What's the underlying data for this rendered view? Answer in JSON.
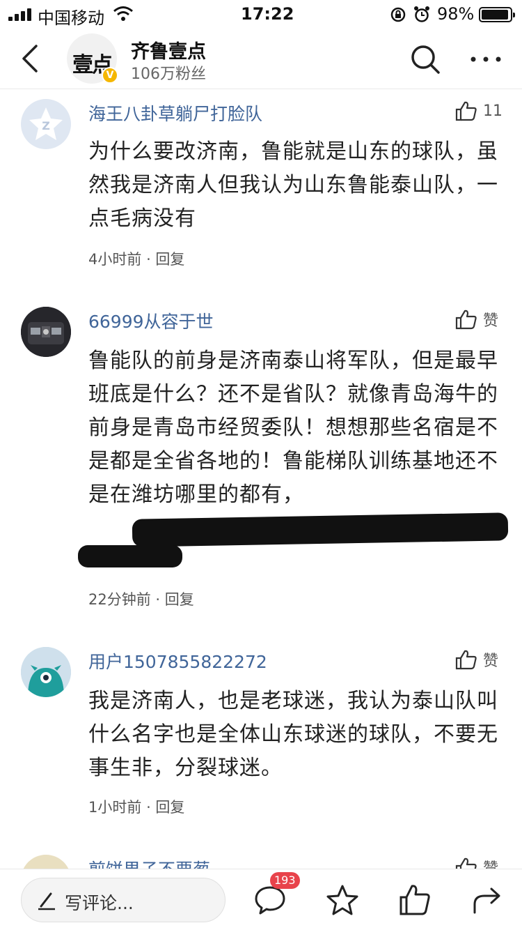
{
  "status_bar": {
    "carrier": "中国移动",
    "time": "17:22",
    "battery": "98%",
    "battery_level": 0.98
  },
  "header": {
    "account_name": "齐鲁壹点",
    "fans": "106万粉丝",
    "logo_text": "壹点"
  },
  "comments": [
    {
      "user": "海王八卦草躺尸打脸队",
      "likes": "11",
      "text": "为什么要改济南，鲁能就是山东的球队，虽然我是济南人但我认为山东鲁能泰山队，一点毛病没有",
      "time": "4小时前",
      "reply": "回复"
    },
    {
      "user": "66999从容于世",
      "likes": "赞",
      "text": "鲁能队的前身是济南泰山将军队，但是最早班底是什么？还不是省队？就像青岛海牛的前身是青岛市经贸委队！想想那些名宿是不是都是全省各地的！鲁能梯队训练基地还不是在潍坊哪里的都有，",
      "time": "22分钟前",
      "reply": "回复"
    },
    {
      "user": "用户1507855822272",
      "likes": "赞",
      "text": "我是济南人，也是老球迷，我认为泰山队叫什么名字也是全体山东球迷的球队，不要无事生非，分裂球迷。",
      "time": "1小时前",
      "reply": "回复"
    },
    {
      "user": "煎饼果子不要葱",
      "likes": "赞"
    }
  ],
  "bottom_bar": {
    "input_placeholder": "写评论...",
    "comment_count": "193"
  },
  "colors": {
    "username": "#406599",
    "badge": "#e8434b",
    "verified": "#f5b700"
  }
}
